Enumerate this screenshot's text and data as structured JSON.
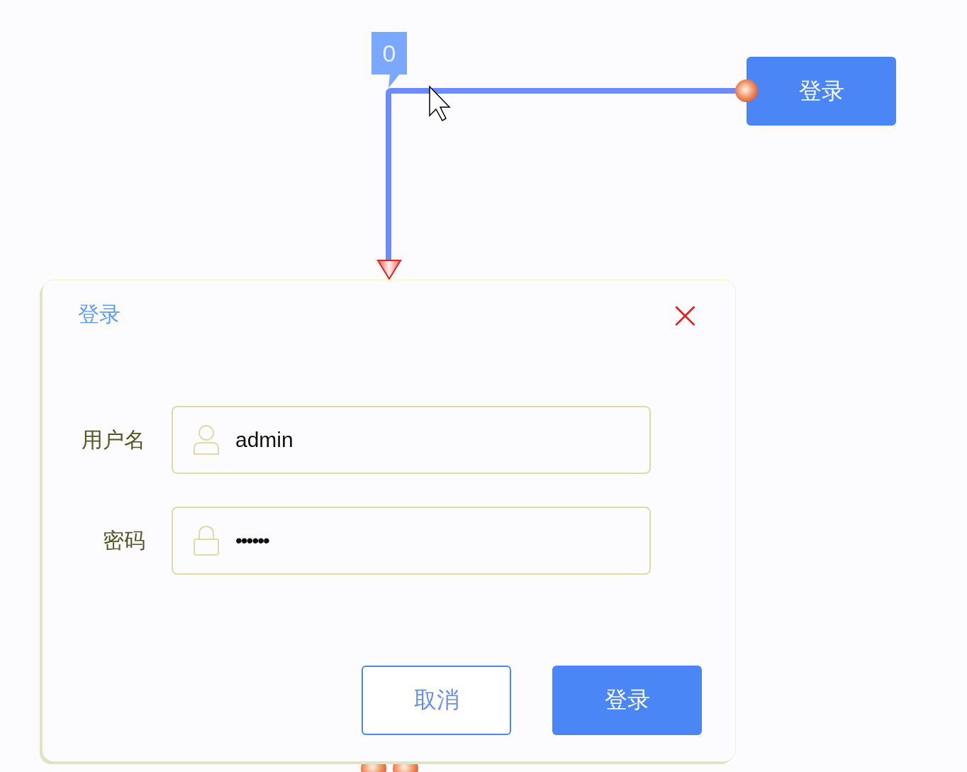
{
  "trigger_button": {
    "label": "登录"
  },
  "connector": {
    "badge": "0"
  },
  "dialog": {
    "title": "登录",
    "close": "×",
    "fields": [
      {
        "kind": "text",
        "label": "用户名",
        "value": "admin"
      },
      {
        "kind": "password",
        "label": "密码",
        "value": "••••••"
      }
    ],
    "buttons": [
      {
        "kind": "secondary",
        "label": "取消"
      },
      {
        "kind": "primary",
        "label": "登录"
      }
    ]
  }
}
